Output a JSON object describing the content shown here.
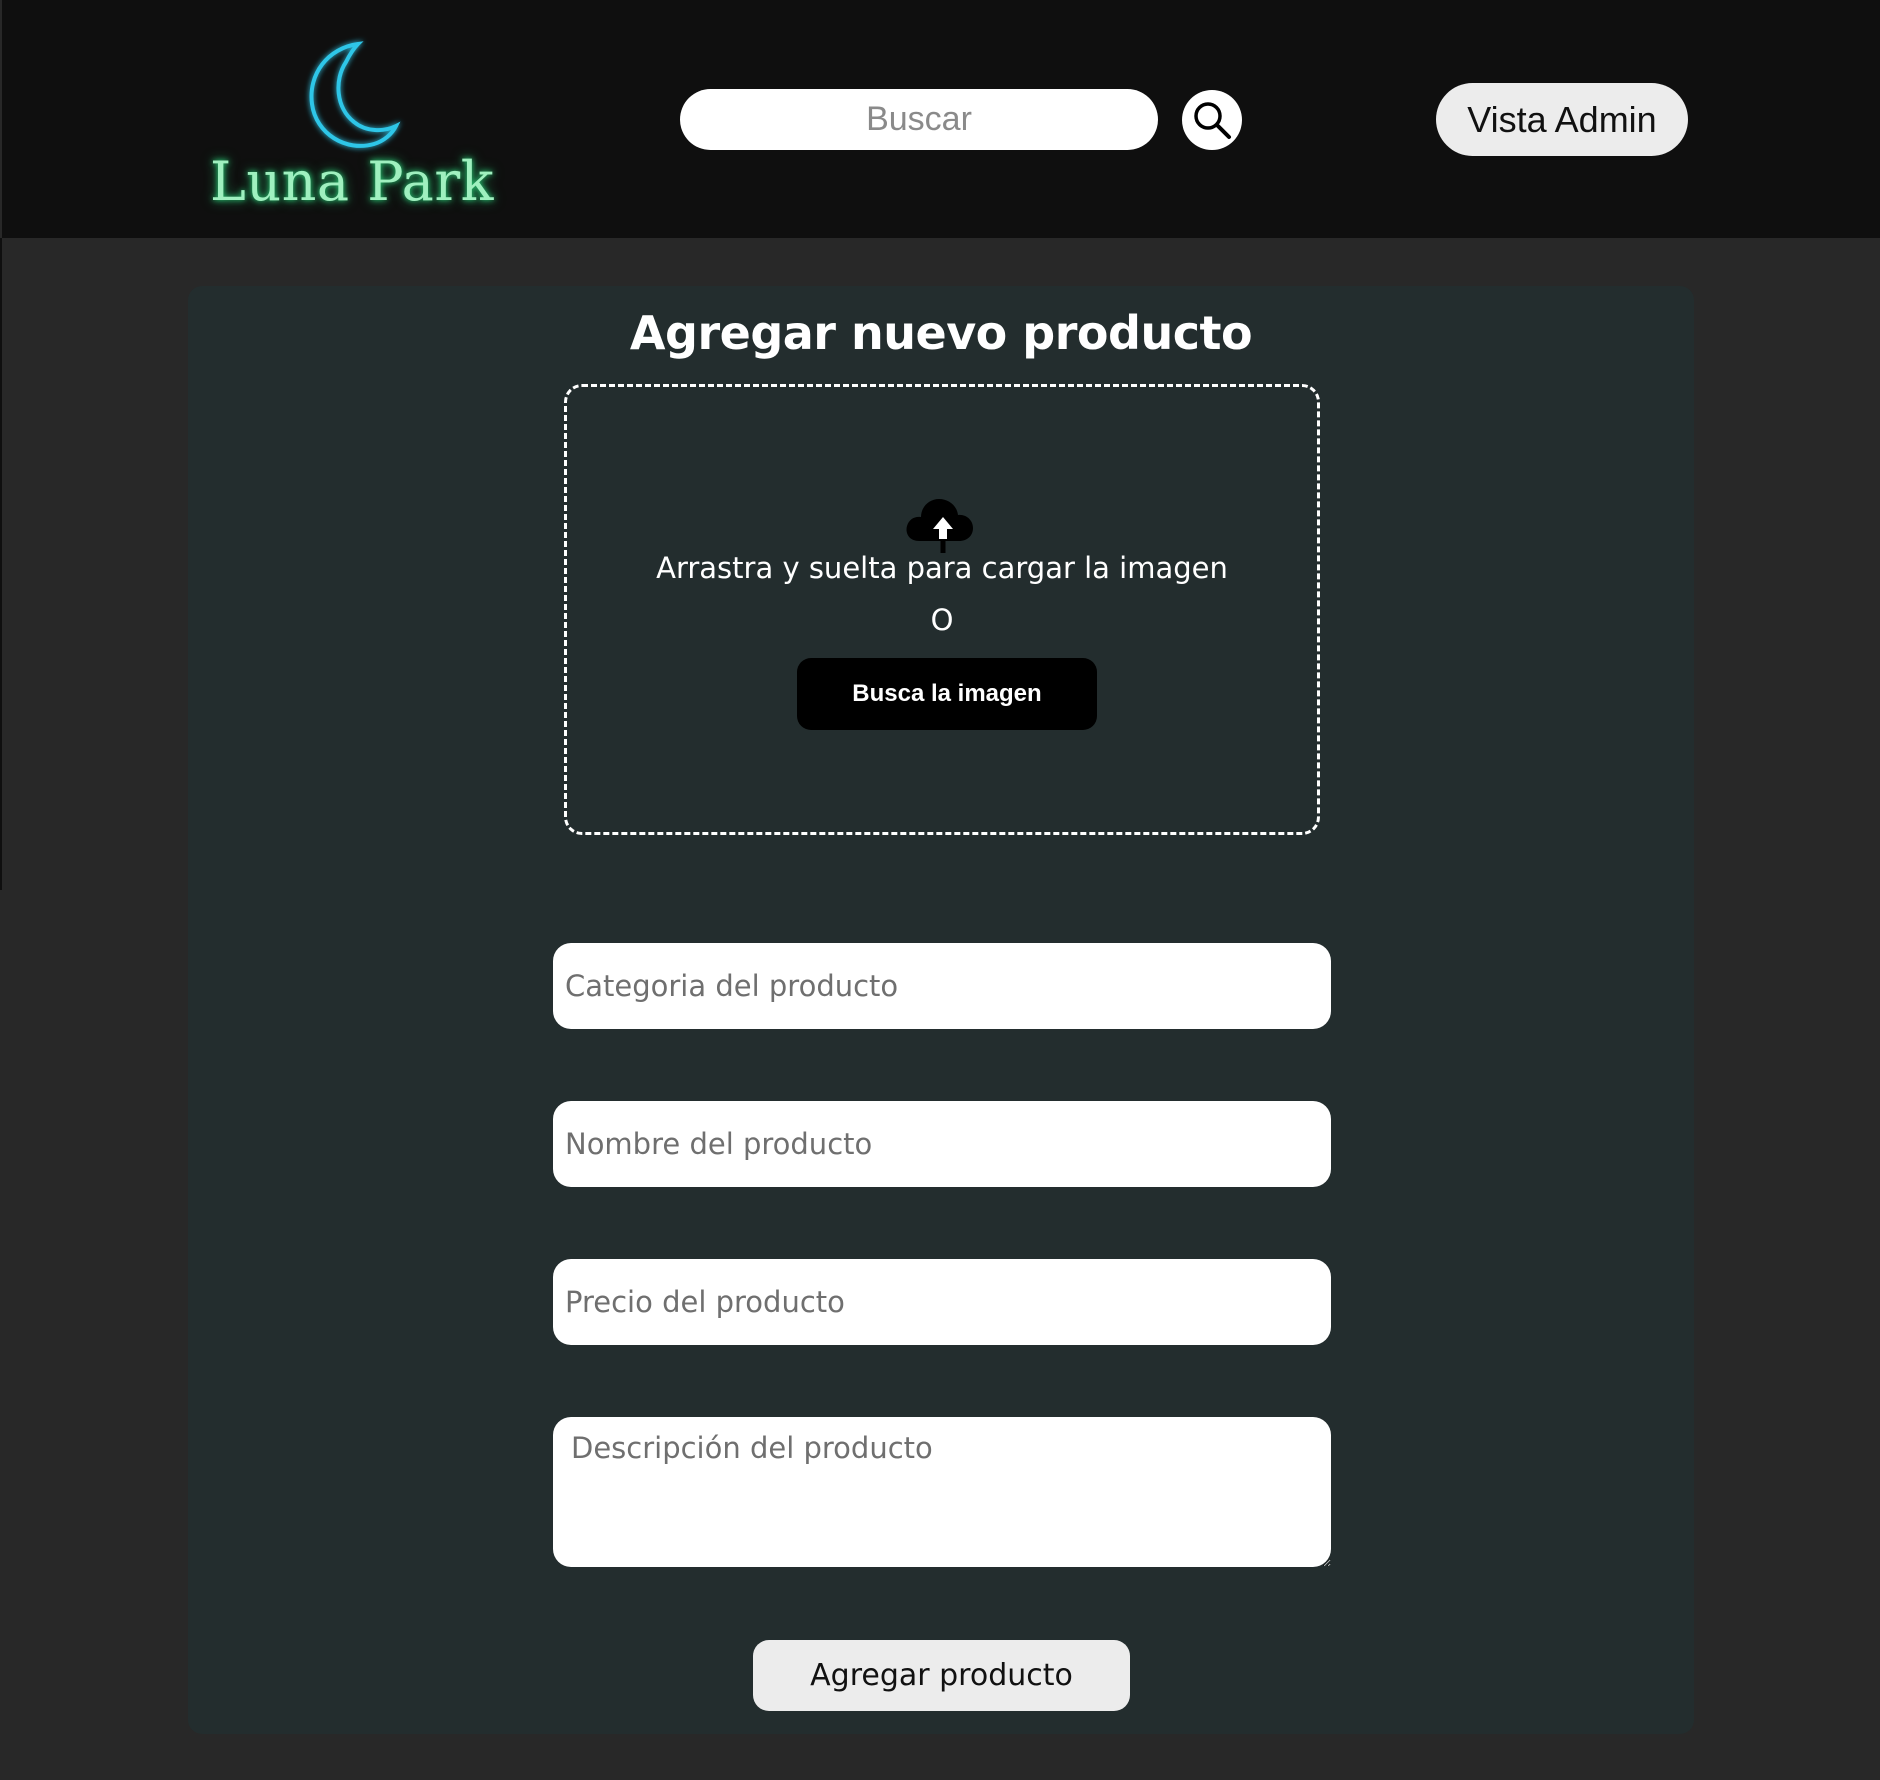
{
  "header": {
    "logo_text": "Luna Park",
    "search_placeholder": "Buscar",
    "admin_button_label": "Vista Admin"
  },
  "form": {
    "title": "Agregar nuevo producto",
    "dropzone": {
      "instruction": "Arrastra y suelta para cargar la imagen",
      "separator": "O",
      "browse_label": "Busca la imagen"
    },
    "fields": {
      "category_placeholder": "Categoria del producto",
      "name_placeholder": "Nombre del producto",
      "price_placeholder": "Precio del producto",
      "description_placeholder": "Descripción del producto"
    },
    "submit_label": "Agregar producto"
  },
  "colors": {
    "page_background": "#282828",
    "header_background": "#0f0f0f",
    "panel_background": "#232d2e",
    "logo_text": "#9ff0bf",
    "moon_glow": "#2ec6e8"
  },
  "icons": {
    "logo": "crescent-moon-icon",
    "search": "magnifier-icon",
    "upload": "cloud-upload-icon"
  }
}
